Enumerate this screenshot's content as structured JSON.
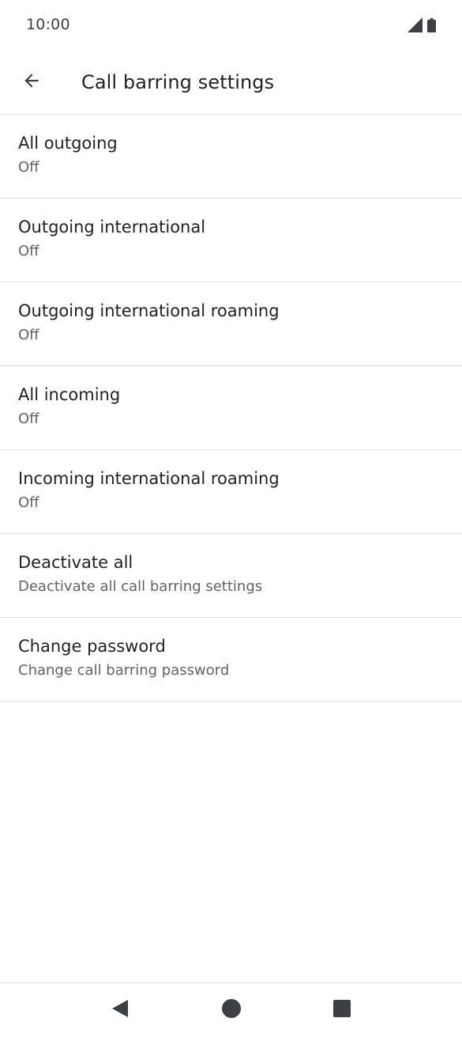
{
  "status_bar": {
    "time": "10:00",
    "signal_icon": "cell-signal-icon",
    "battery_icon": "battery-icon"
  },
  "app_bar": {
    "back_icon": "arrow-back-icon",
    "title": "Call barring settings"
  },
  "settings": [
    {
      "title": "All outgoing",
      "summary": "Off"
    },
    {
      "title": "Outgoing international",
      "summary": "Off"
    },
    {
      "title": "Outgoing international roaming",
      "summary": "Off"
    },
    {
      "title": "All incoming",
      "summary": "Off"
    },
    {
      "title": "Incoming international roaming",
      "summary": "Off"
    },
    {
      "title": "Deactivate all",
      "summary": "Deactivate all call barring settings"
    },
    {
      "title": "Change password",
      "summary": "Change call barring password"
    }
  ],
  "nav_bar": {
    "back_icon": "nav-back-triangle-icon",
    "home_icon": "nav-home-circle-icon",
    "recents_icon": "nav-recents-square-icon"
  },
  "colors": {
    "text_primary": "#202124",
    "text_secondary": "#5f6368",
    "divider": "#dadce0",
    "nav_icon": "#3c4043"
  }
}
